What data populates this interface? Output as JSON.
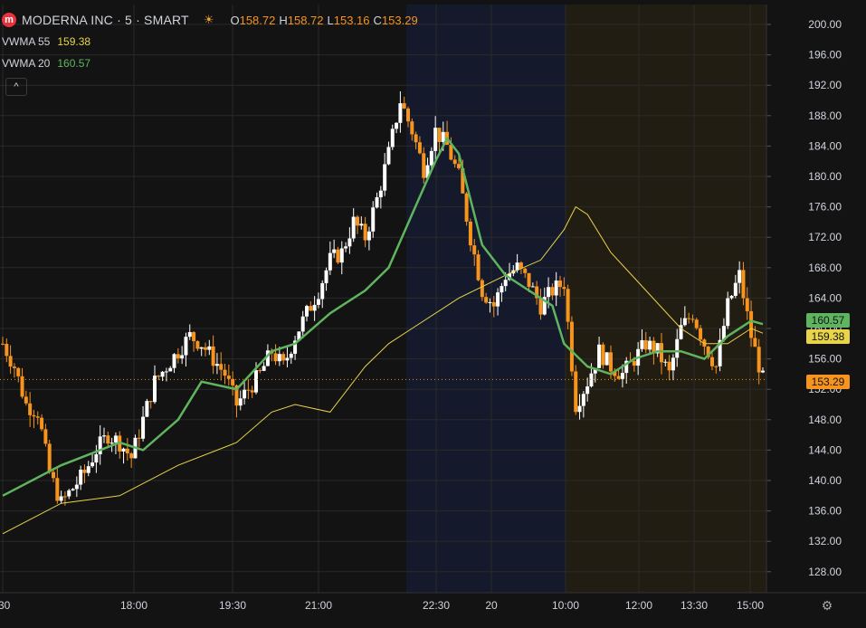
{
  "legend": {
    "logo_letter": "m",
    "title": "MODERNA INC · 5 · SMART",
    "ohlc": {
      "o_label": "O",
      "o": "158.72",
      "h_label": "H",
      "h": "158.72",
      "l_label": "L",
      "l": "153.16",
      "c_label": "C",
      "c": "153.29"
    },
    "ind1": {
      "name": "VWMA 55",
      "value": "159.38"
    },
    "ind2": {
      "name": "VWMA 20",
      "value": "160.57"
    },
    "collapse_glyph": "^"
  },
  "price_axis": {
    "labels": [
      "200.00",
      "196.00",
      "192.00",
      "188.00",
      "184.00",
      "180.00",
      "176.00",
      "172.00",
      "168.00",
      "164.00",
      "160.00",
      "156.00",
      "152.00",
      "148.00",
      "144.00",
      "140.00",
      "136.00",
      "132.00",
      "128.00"
    ],
    "tags": {
      "vwma20": "160.57",
      "vwma55": "159.38",
      "last": "153.29"
    }
  },
  "time_axis": {
    "labels": [
      ":30",
      "18:00",
      "19:30",
      "21:00",
      "22:30",
      "20",
      "10:00",
      "12:00",
      "13:30",
      "15:00"
    ]
  },
  "colors": {
    "background": "#131313",
    "session_pre": "#141a2b",
    "session_post": "#221d12",
    "up": "#ffffff",
    "down": "#f7941d",
    "vwma20": "#5fb55f",
    "vwma55": "#e8d449",
    "grid": "#2a2a2a"
  },
  "chart_data": {
    "type": "candlestick",
    "symbol": "MODERNA INC",
    "interval": "5",
    "exchange": "SMART",
    "ylim": [
      126,
      202
    ],
    "x_ticks": [
      ":30",
      "18:00",
      "19:30",
      "21:00",
      "22:30",
      "20",
      "10:00",
      "12:00",
      "13:30",
      "15:00"
    ],
    "last_close": 153.29,
    "close_path": [
      [
        0,
        158
      ],
      [
        6,
        155
      ],
      [
        12,
        150
      ],
      [
        18,
        149
      ],
      [
        24,
        141
      ],
      [
        30,
        137
      ],
      [
        36,
        139
      ],
      [
        42,
        141
      ],
      [
        48,
        144
      ],
      [
        54,
        146
      ],
      [
        60,
        145
      ],
      [
        66,
        143
      ],
      [
        72,
        148
      ],
      [
        78,
        153
      ],
      [
        84,
        155
      ],
      [
        90,
        157
      ],
      [
        96,
        159
      ],
      [
        102,
        158
      ],
      [
        108,
        156
      ],
      [
        114,
        154
      ],
      [
        120,
        150
      ],
      [
        126,
        152
      ],
      [
        132,
        154
      ],
      [
        138,
        157
      ],
      [
        144,
        155
      ],
      [
        150,
        159
      ],
      [
        156,
        162
      ],
      [
        162,
        165
      ],
      [
        168,
        169
      ],
      [
        174,
        170
      ],
      [
        180,
        174
      ],
      [
        186,
        172
      ],
      [
        192,
        177
      ],
      [
        198,
        183
      ],
      [
        204,
        190
      ],
      [
        210,
        186
      ],
      [
        216,
        181
      ],
      [
        222,
        186
      ],
      [
        228,
        184
      ],
      [
        234,
        180
      ],
      [
        240,
        172
      ],
      [
        246,
        165
      ],
      [
        252,
        163
      ],
      [
        258,
        167
      ],
      [
        264,
        168
      ],
      [
        270,
        166
      ],
      [
        276,
        163
      ],
      [
        282,
        165
      ],
      [
        288,
        166
      ],
      [
        294,
        150
      ],
      [
        300,
        153
      ],
      [
        306,
        157
      ],
      [
        312,
        155
      ],
      [
        318,
        154
      ],
      [
        324,
        156
      ],
      [
        330,
        158
      ],
      [
        336,
        157
      ],
      [
        342,
        154
      ],
      [
        348,
        160
      ],
      [
        354,
        162
      ],
      [
        360,
        158
      ],
      [
        366,
        155
      ],
      [
        372,
        163
      ],
      [
        378,
        167
      ],
      [
        384,
        159
      ],
      [
        390,
        153.29
      ]
    ],
    "vwma20": [
      [
        0,
        138
      ],
      [
        30,
        142
      ],
      [
        60,
        145
      ],
      [
        72,
        144
      ],
      [
        90,
        148
      ],
      [
        102,
        153
      ],
      [
        120,
        152
      ],
      [
        138,
        157
      ],
      [
        150,
        158
      ],
      [
        168,
        162
      ],
      [
        186,
        165
      ],
      [
        198,
        168
      ],
      [
        210,
        175
      ],
      [
        222,
        182
      ],
      [
        228,
        185
      ],
      [
        234,
        183
      ],
      [
        246,
        171
      ],
      [
        258,
        167
      ],
      [
        270,
        165
      ],
      [
        282,
        163
      ],
      [
        288,
        158
      ],
      [
        300,
        155
      ],
      [
        312,
        154
      ],
      [
        324,
        156
      ],
      [
        336,
        157
      ],
      [
        348,
        157
      ],
      [
        360,
        156
      ],
      [
        372,
        159
      ],
      [
        384,
        161
      ],
      [
        390,
        160.57
      ]
    ],
    "vwma55": [
      [
        0,
        133
      ],
      [
        30,
        137
      ],
      [
        60,
        138
      ],
      [
        90,
        142
      ],
      [
        120,
        145
      ],
      [
        138,
        149
      ],
      [
        150,
        150
      ],
      [
        168,
        149
      ],
      [
        186,
        155
      ],
      [
        198,
        158
      ],
      [
        210,
        160
      ],
      [
        234,
        164
      ],
      [
        258,
        167
      ],
      [
        276,
        169
      ],
      [
        288,
        173
      ],
      [
        294,
        176
      ],
      [
        300,
        175
      ],
      [
        312,
        170
      ],
      [
        330,
        165
      ],
      [
        348,
        160
      ],
      [
        360,
        158
      ],
      [
        372,
        158
      ],
      [
        384,
        160
      ],
      [
        390,
        159.38
      ]
    ]
  }
}
